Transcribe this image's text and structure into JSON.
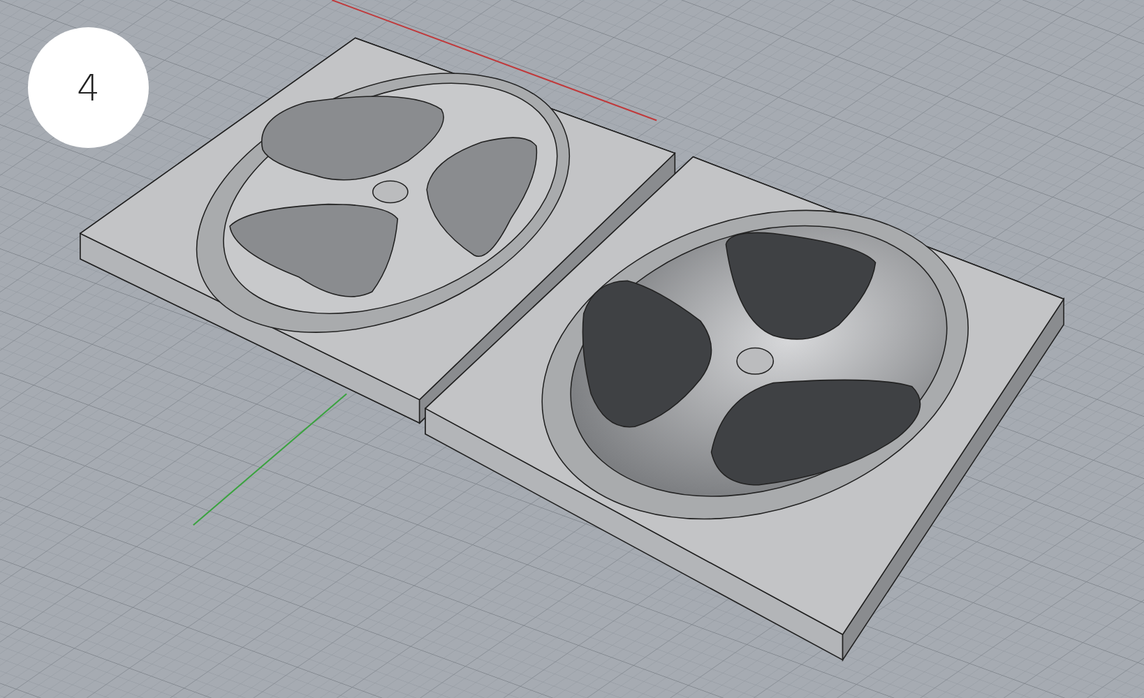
{
  "step_badge": {
    "label": "4"
  }
}
